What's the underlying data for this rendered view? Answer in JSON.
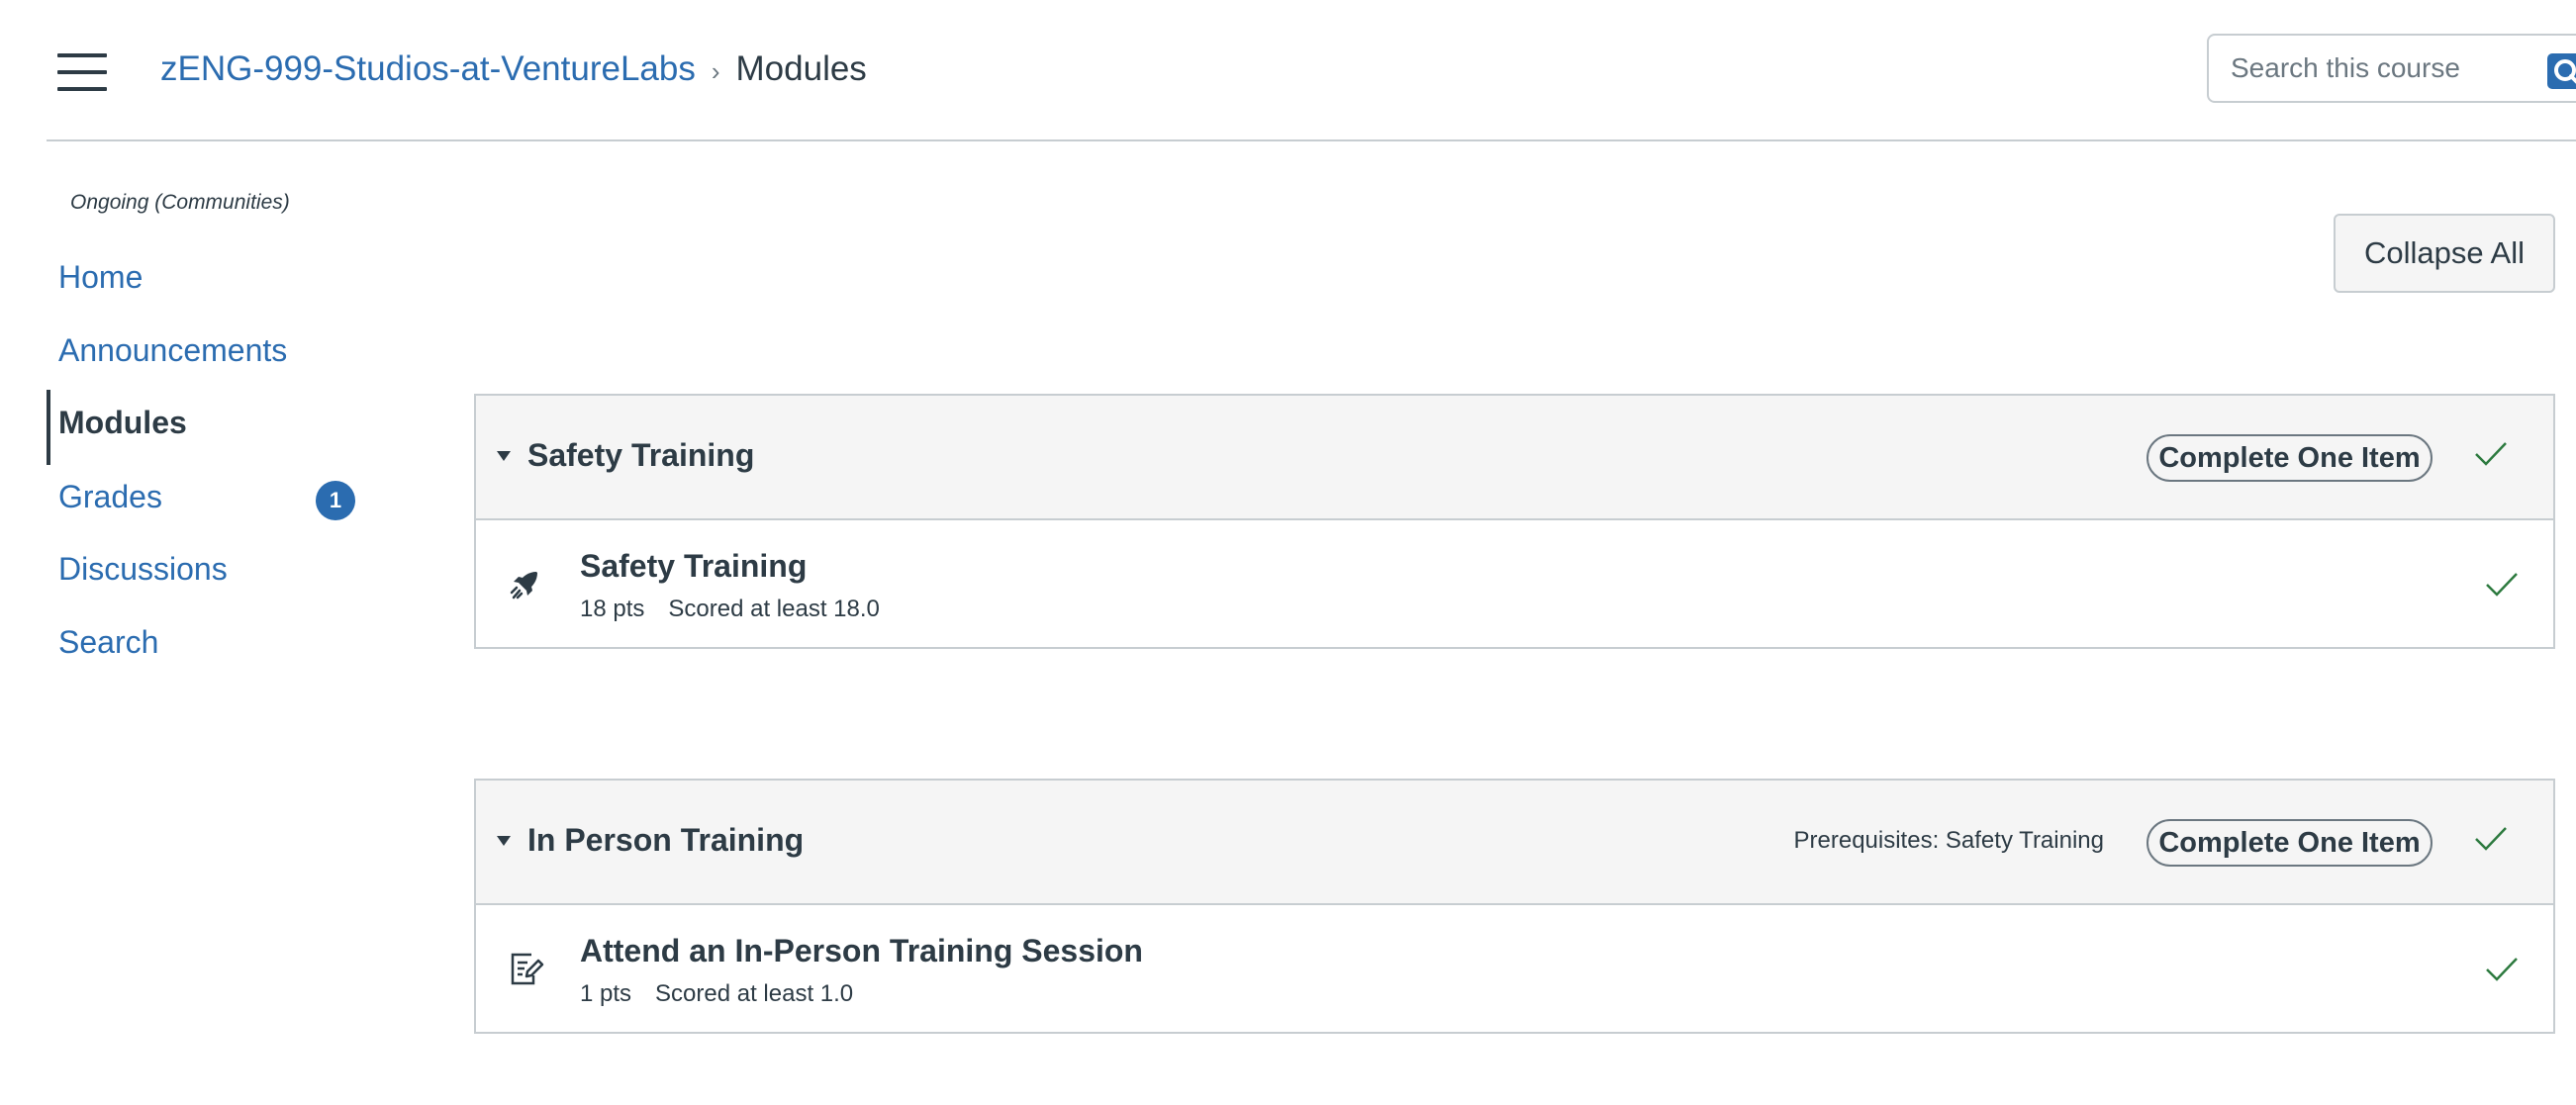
{
  "header": {
    "course_link": "zENG-999-Studios-at-VentureLabs",
    "separator": "›",
    "current_page": "Modules",
    "search_placeholder": "Search this course"
  },
  "sidebar": {
    "term": "Ongoing (Communities)",
    "items": [
      {
        "label": "Home"
      },
      {
        "label": "Announcements"
      },
      {
        "label": "Modules",
        "active": true
      },
      {
        "label": "Grades",
        "badge": "1"
      },
      {
        "label": "Discussions"
      },
      {
        "label": "Search"
      }
    ]
  },
  "toolbar": {
    "collapse_all_label": "Collapse All"
  },
  "modules": [
    {
      "title": "Safety Training",
      "prerequisites": "",
      "requirement": "Complete One Item",
      "completed": true,
      "items": [
        {
          "icon": "rocket-icon",
          "title": "Safety Training",
          "points": "18 pts",
          "requirement": "Scored at least 18.0",
          "completed": true
        }
      ]
    },
    {
      "title": "In Person Training",
      "prerequisites": "Prerequisites: Safety Training",
      "requirement": "Complete One Item",
      "completed": true,
      "items": [
        {
          "icon": "assignment-icon",
          "title": "Attend an In-Person Training Session",
          "points": "1 pts",
          "requirement": "Scored at least 1.0",
          "completed": true
        }
      ]
    }
  ],
  "colors": {
    "link": "#2b6cb0",
    "text": "#2d3b45",
    "success": "#2d7a3f",
    "header_bg": "#f5f5f5",
    "border": "#c7cdd1"
  }
}
